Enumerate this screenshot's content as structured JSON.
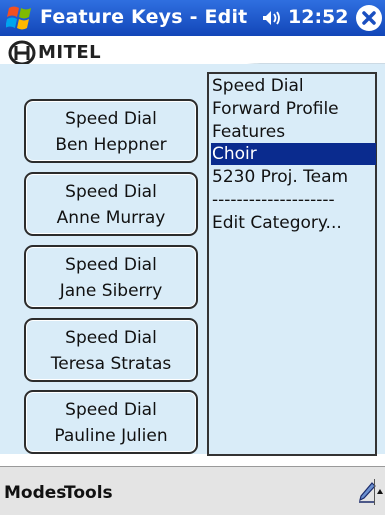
{
  "titlebar": {
    "title": "Feature Keys - Edit",
    "time": "12:52",
    "icons": {
      "start": "windows-flag-icon",
      "volume": "speaker-icon",
      "close": "close-icon"
    }
  },
  "header": {
    "logo_text": "MITEL",
    "logo_icon": "mitel-logo-icon"
  },
  "speed_dials": [
    {
      "type": "Speed Dial",
      "name": "Ben Heppner"
    },
    {
      "type": "Speed Dial",
      "name": "Anne Murray"
    },
    {
      "type": "Speed Dial",
      "name": "Jane Siberry"
    },
    {
      "type": "Speed Dial",
      "name": "Teresa Stratas"
    },
    {
      "type": "Speed Dial",
      "name": "Pauline Julien"
    }
  ],
  "categories": {
    "items": [
      "Speed Dial",
      "Forward Profile",
      "Features",
      "Choir",
      "5230 Proj. Team",
      "--------------------",
      "Edit Category..."
    ],
    "selected": "Choir"
  },
  "menubar": {
    "modes_label": "Modes",
    "tools_label": "Tools",
    "icons": {
      "input": "pen-icon",
      "sip": "up-arrow-icon"
    }
  },
  "colors": {
    "title_bar": "#1f5bd0",
    "panel": "#d9ecf8",
    "selection": "#0a2b8e",
    "command_bar": "#e4e4e4"
  }
}
